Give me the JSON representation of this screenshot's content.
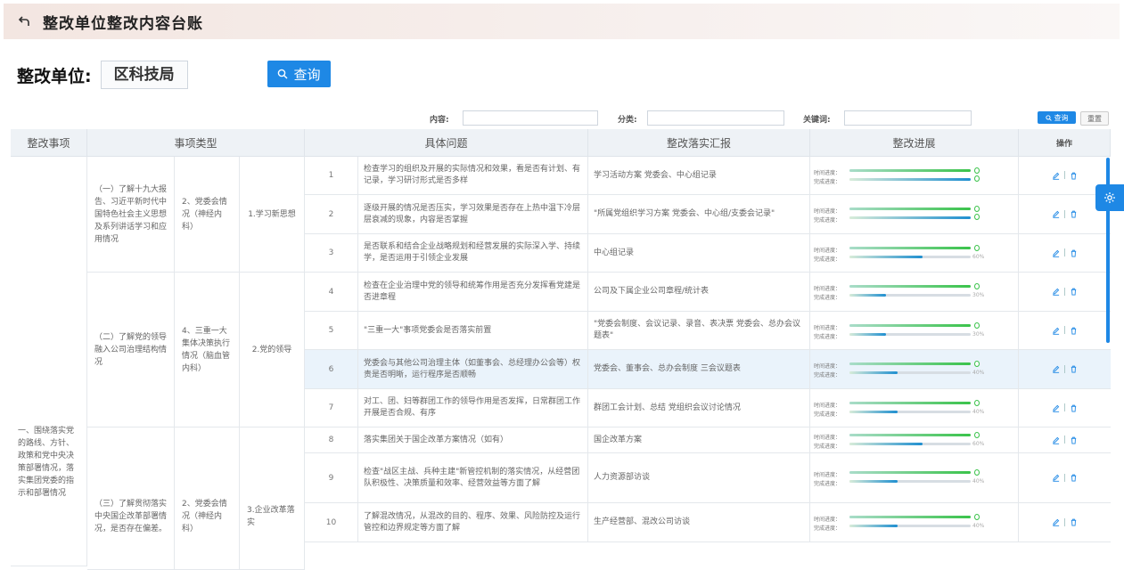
{
  "header": {
    "title": "整改单位整改内容台账",
    "back_icon": "back-arrow-icon"
  },
  "unit": {
    "label": "整改单位:",
    "value": "区科技局"
  },
  "query_button": {
    "label": "查询",
    "icon": "search-icon"
  },
  "filters": {
    "content_label": "内容:",
    "category_label": "分类:",
    "keyword_label": "关键词:",
    "search_label": "查询",
    "reset_label": "重置"
  },
  "table": {
    "headers": [
      "整改事项",
      "事项类型",
      "具体问题",
      "整改落实汇报",
      "整改进展",
      "操作"
    ],
    "matter": "一、围绕落实党的路线、方针、政策和党中央决策部署情况，落实集团党委的指示和部署情况",
    "groups": [
      {
        "type1": "（一）了解十九大报告、习近平新时代中国特色社会主义思想及系列讲话学习和应用情况",
        "type2": "2、党委会情况（神经内科）",
        "type3": "1.学习新思想"
      },
      {
        "type1": "（二）了解党的领导融入公司治理结构情况",
        "type2": "4、三重一大集体决策执行情况（脑血管内科）",
        "type3": "2.党的领导"
      },
      {
        "type1": "（三）了解贯彻落实中央国企改革部署情况，是否存在偏差。",
        "type2": "2、党委会情况（神经内科）",
        "type3": "3.企业改革落实"
      }
    ],
    "progress_labels": {
      "time": "时间进度：",
      "done": "完成进度："
    },
    "rows": [
      {
        "no": "1",
        "issue": "检查学习的组织及开展的实际情况和效果，看是否有计划、有记录，学习研讨形式是否多样",
        "report": "学习活动方案 党委会、中心组记录",
        "time": 100,
        "done": 100,
        "pct": "",
        "zero": "0"
      },
      {
        "no": "2",
        "issue": "逐级开展的情况是否压实，学习效果是否存在上热中温下冷层层衰减的现象，内容是否掌握",
        "report": "\"所属党组织学习方案 党委会、中心组/支委会记录\"",
        "time": 100,
        "done": 100,
        "pct": "",
        "zero": "0"
      },
      {
        "no": "3",
        "issue": "是否联系和结合企业战略规划和经营发展的实际深入学、持续学，是否运用于引领企业发展",
        "report": "中心组记录",
        "time": 100,
        "done": 60,
        "pct": "60%",
        "zero": "0"
      },
      {
        "no": "4",
        "issue": "检查在企业治理中党的领导和统筹作用是否充分发挥看党建是否进章程",
        "report": "公司及下属企业公司章程/统计表",
        "time": 100,
        "done": 30,
        "pct": "30%",
        "zero": "0"
      },
      {
        "no": "5",
        "issue": "\"三重一大\"事项党委会是否落实前置",
        "report": "\"党委会制度、会议记录、录音、表决票 党委会、总办会议题表\"",
        "time": 100,
        "done": 30,
        "pct": "30%",
        "zero": "0"
      },
      {
        "no": "6",
        "issue": "党委会与其他公司治理主体（如董事会、总经理办公会等）权责是否明晰，运行程序是否顺畅",
        "report": "党委会、董事会、总办会制度 三会议题表",
        "time": 100,
        "done": 40,
        "pct": "40%",
        "zero": "0"
      },
      {
        "no": "7",
        "issue": "对工、团、妇等群团工作的领导作用是否发挥，日常群团工作开展是否合规、有序",
        "report": "群团工会计划、总结 党组织会议讨论情况",
        "time": 100,
        "done": 40,
        "pct": "40%",
        "zero": "0"
      },
      {
        "no": "8",
        "issue": "落实集团关于国企改革方案情况（如有）",
        "report": "国企改革方案",
        "time": 100,
        "done": 60,
        "pct": "60%",
        "zero": "0"
      },
      {
        "no": "9",
        "issue": "检查\"战区主战、兵种主建\"新管控机制的落实情况，从经营团队积极性、决策质量和效率、经营效益等方面了解",
        "report": "人力资源部访谈",
        "time": 100,
        "done": 40,
        "pct": "40%",
        "zero": "0"
      },
      {
        "no": "10",
        "issue": "了解混改情况，从混改的目的、程序、效果、风险防控及运行管控和边界规定等方面了解",
        "report": "生产经营部、混改公司访谈",
        "time": 100,
        "done": 40,
        "pct": "40%",
        "zero": "0"
      }
    ]
  },
  "colors": {
    "accent": "#1e88e5",
    "progress_green": "#3ac34a",
    "progress_blue": "#1f8fd0",
    "highlight_row": "#eaf3fb"
  }
}
